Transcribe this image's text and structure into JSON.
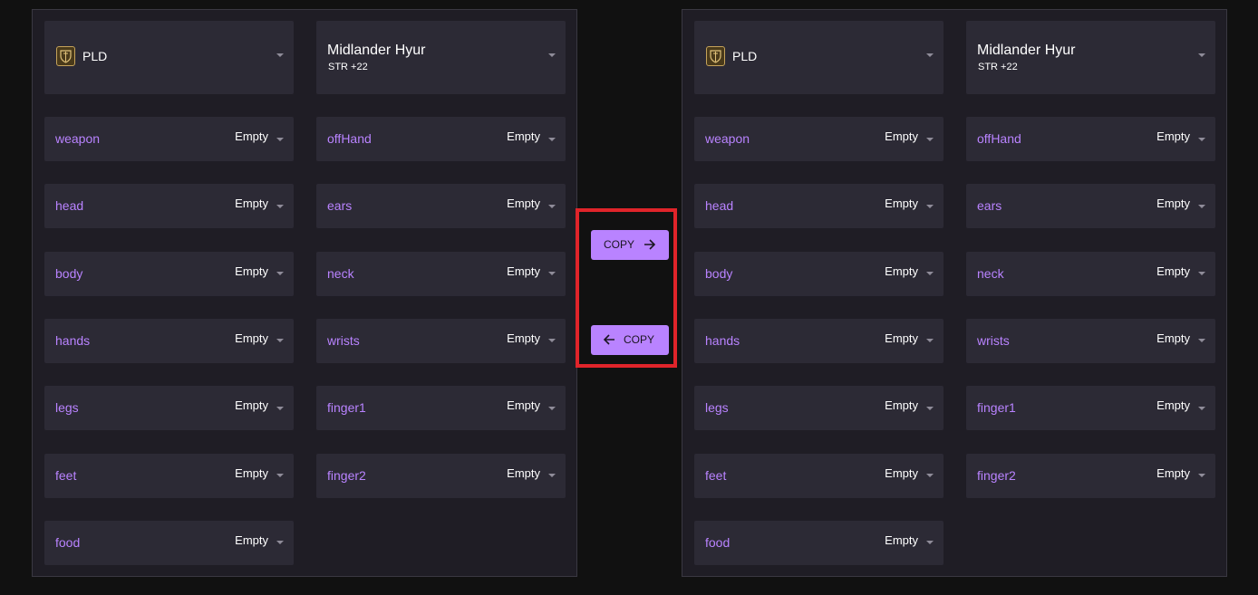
{
  "copy_right_label": "COPY",
  "copy_left_label": "COPY",
  "accent_color": "#b983ff",
  "highlight_color": "#e0242a",
  "panels": [
    {
      "job": "PLD",
      "race": "Midlander Hyur",
      "race_stat": "STR +22",
      "slots": [
        {
          "label": "weapon",
          "value": "Empty"
        },
        {
          "label": "offHand",
          "value": "Empty"
        },
        {
          "label": "head",
          "value": "Empty"
        },
        {
          "label": "ears",
          "value": "Empty"
        },
        {
          "label": "body",
          "value": "Empty"
        },
        {
          "label": "neck",
          "value": "Empty"
        },
        {
          "label": "hands",
          "value": "Empty"
        },
        {
          "label": "wrists",
          "value": "Empty"
        },
        {
          "label": "legs",
          "value": "Empty"
        },
        {
          "label": "finger1",
          "value": "Empty"
        },
        {
          "label": "feet",
          "value": "Empty"
        },
        {
          "label": "finger2",
          "value": "Empty"
        },
        {
          "label": "food",
          "value": "Empty"
        }
      ]
    },
    {
      "job": "PLD",
      "race": "Midlander Hyur",
      "race_stat": "STR +22",
      "slots": [
        {
          "label": "weapon",
          "value": "Empty"
        },
        {
          "label": "offHand",
          "value": "Empty"
        },
        {
          "label": "head",
          "value": "Empty"
        },
        {
          "label": "ears",
          "value": "Empty"
        },
        {
          "label": "body",
          "value": "Empty"
        },
        {
          "label": "neck",
          "value": "Empty"
        },
        {
          "label": "hands",
          "value": "Empty"
        },
        {
          "label": "wrists",
          "value": "Empty"
        },
        {
          "label": "legs",
          "value": "Empty"
        },
        {
          "label": "finger1",
          "value": "Empty"
        },
        {
          "label": "feet",
          "value": "Empty"
        },
        {
          "label": "finger2",
          "value": "Empty"
        },
        {
          "label": "food",
          "value": "Empty"
        }
      ]
    }
  ]
}
